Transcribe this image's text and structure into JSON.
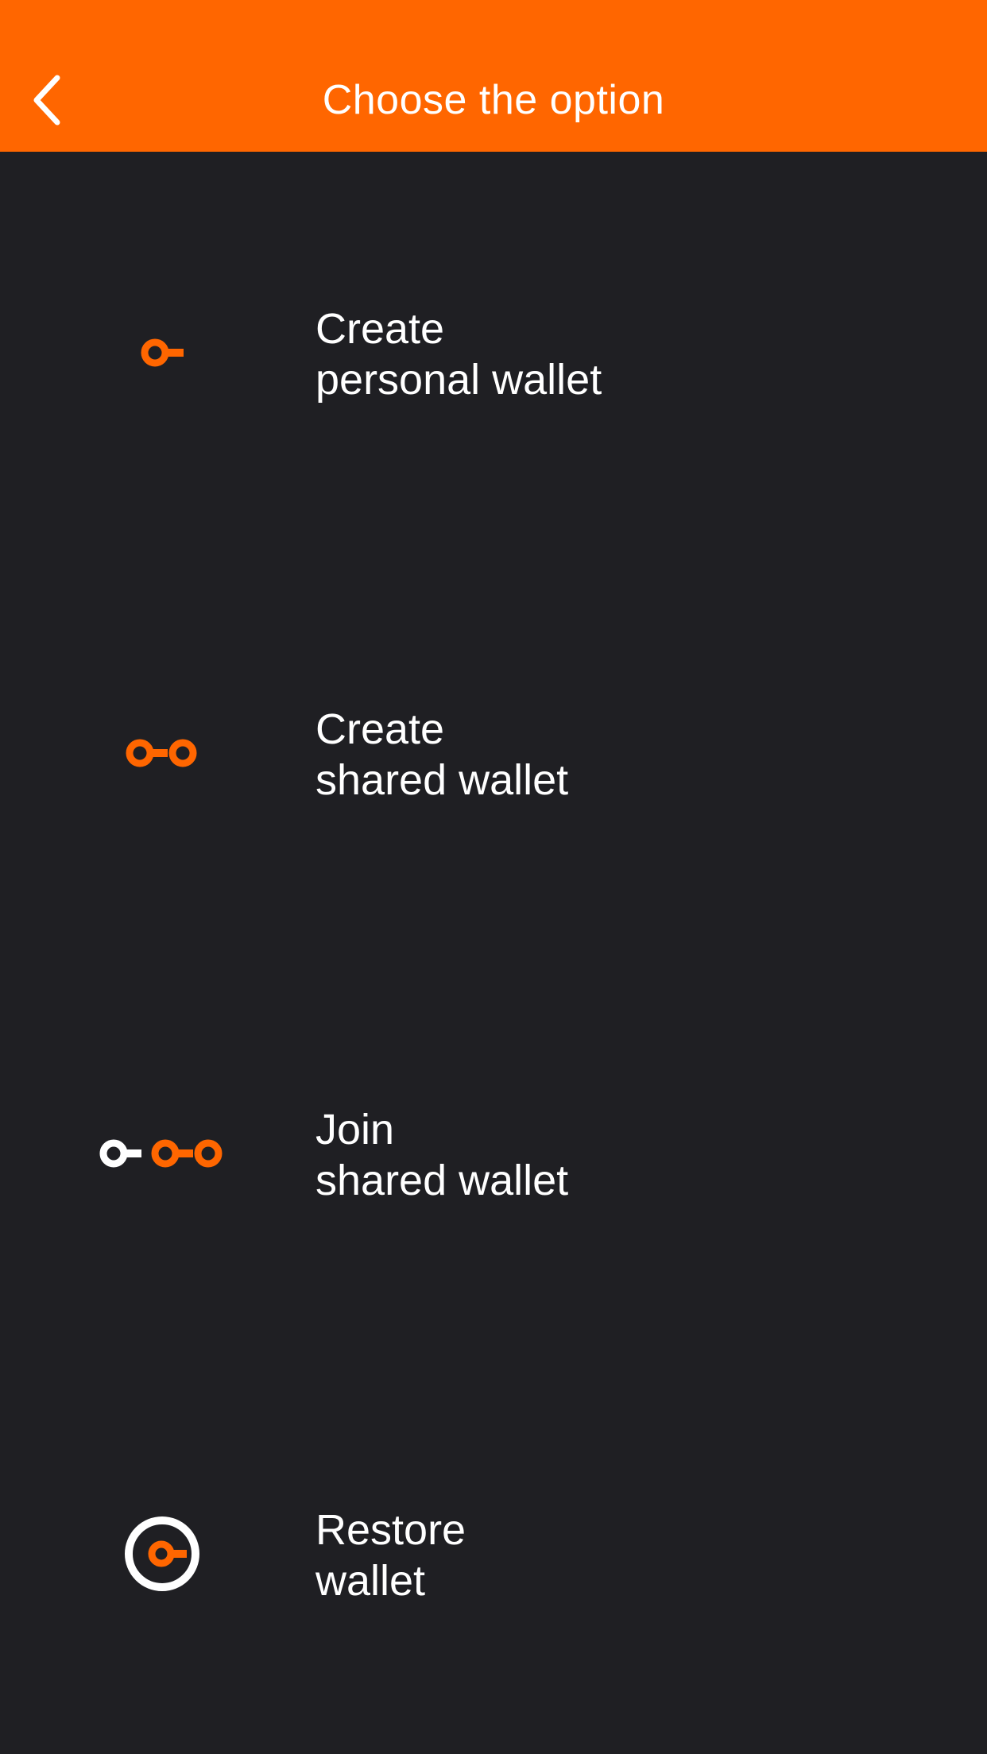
{
  "header": {
    "title": "Choose the option",
    "back_icon": "chevron-left-icon"
  },
  "colors": {
    "accent": "#ff6600",
    "background": "#1f1f23",
    "text": "#ffffff"
  },
  "options": [
    {
      "line1": "Create",
      "line2": "personal wallet",
      "icon": "single-key-icon"
    },
    {
      "line1": "Create",
      "line2": "shared wallet",
      "icon": "shared-key-icon"
    },
    {
      "line1": "Join",
      "line2": "shared wallet",
      "icon": "join-key-icon"
    },
    {
      "line1": "Restore",
      "line2": "wallet",
      "icon": "restore-key-icon"
    }
  ]
}
